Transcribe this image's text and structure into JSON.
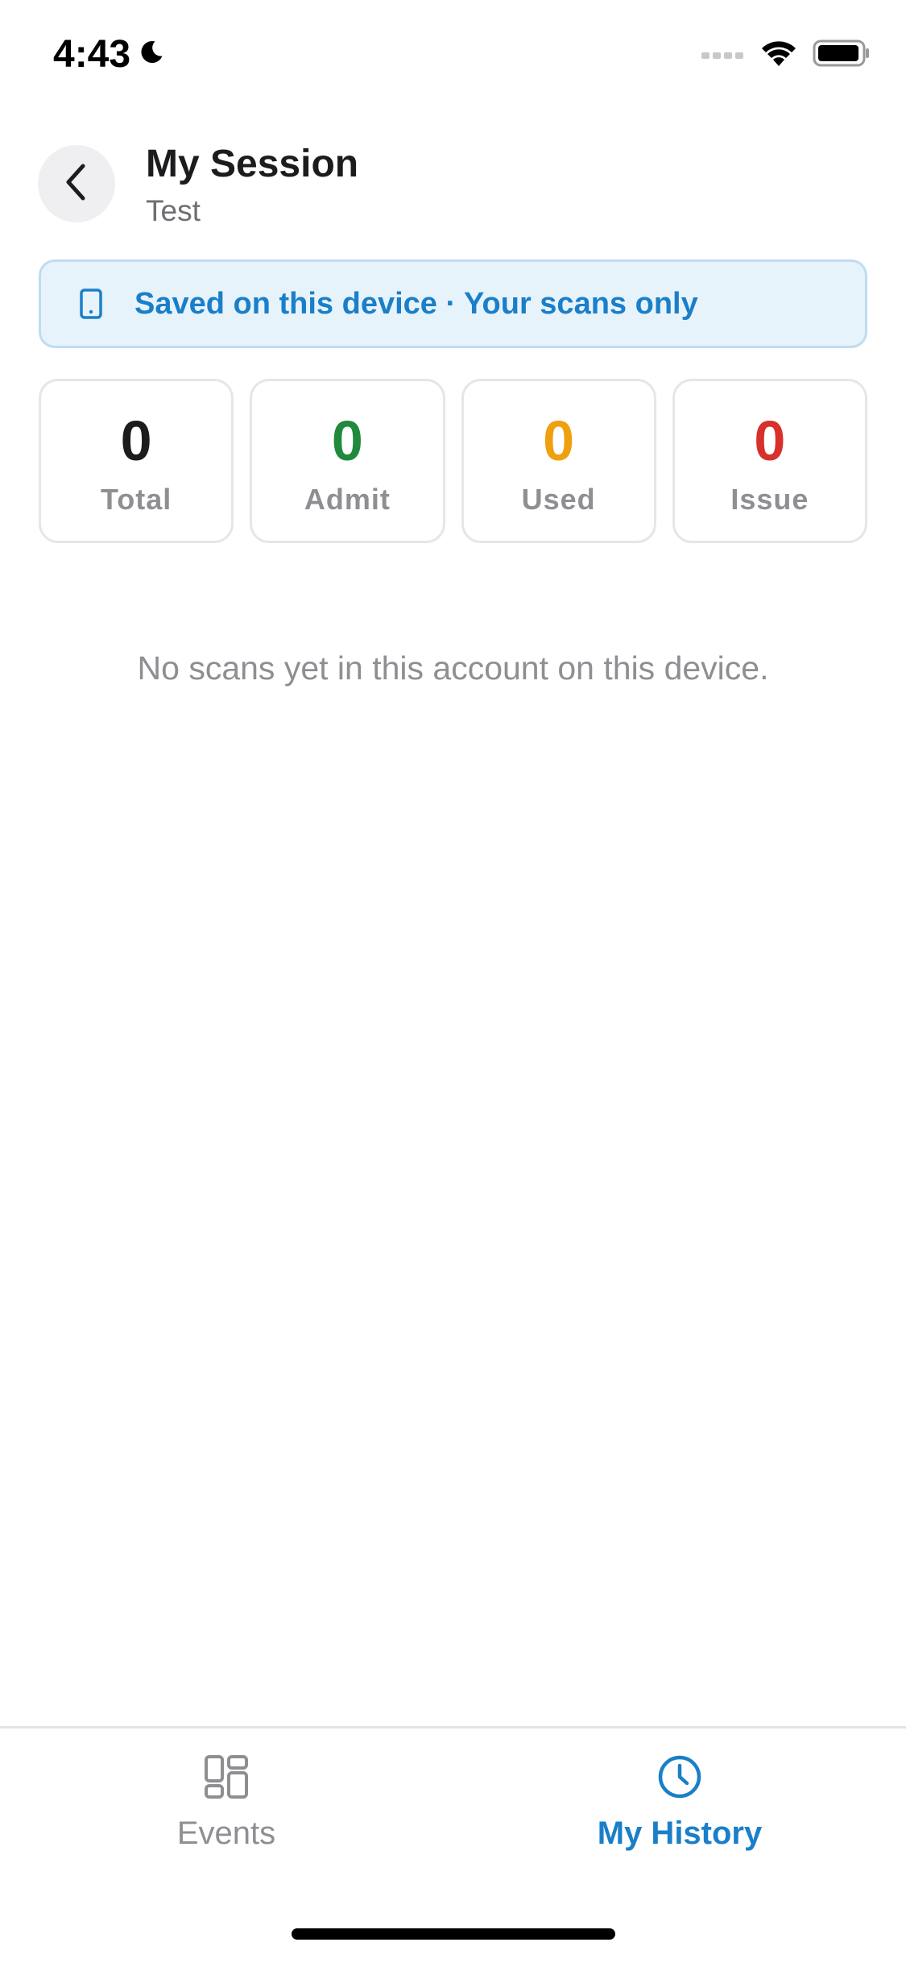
{
  "status_bar": {
    "time": "4:43"
  },
  "header": {
    "title": "My Session",
    "subtitle": "Test"
  },
  "banner": {
    "text": "Saved on this device · Your scans only"
  },
  "stats": [
    {
      "value": "0",
      "label": "Total",
      "color": "#1c1c1e"
    },
    {
      "value": "0",
      "label": "Admit",
      "color": "#1f8a3b"
    },
    {
      "value": "0",
      "label": "Used",
      "color": "#f0a00f"
    },
    {
      "value": "0",
      "label": "Issue",
      "color": "#d8302b"
    }
  ],
  "empty_state": {
    "text": "No scans yet in this account on this device."
  },
  "tab_bar": {
    "tabs": [
      {
        "label": "Events",
        "icon": "grid-icon",
        "active": false
      },
      {
        "label": "My History",
        "icon": "clock-icon",
        "active": true
      }
    ]
  },
  "colors": {
    "accent": "#1a7fc8",
    "banner_bg": "#e7f3fb",
    "muted": "#8e8e93"
  }
}
